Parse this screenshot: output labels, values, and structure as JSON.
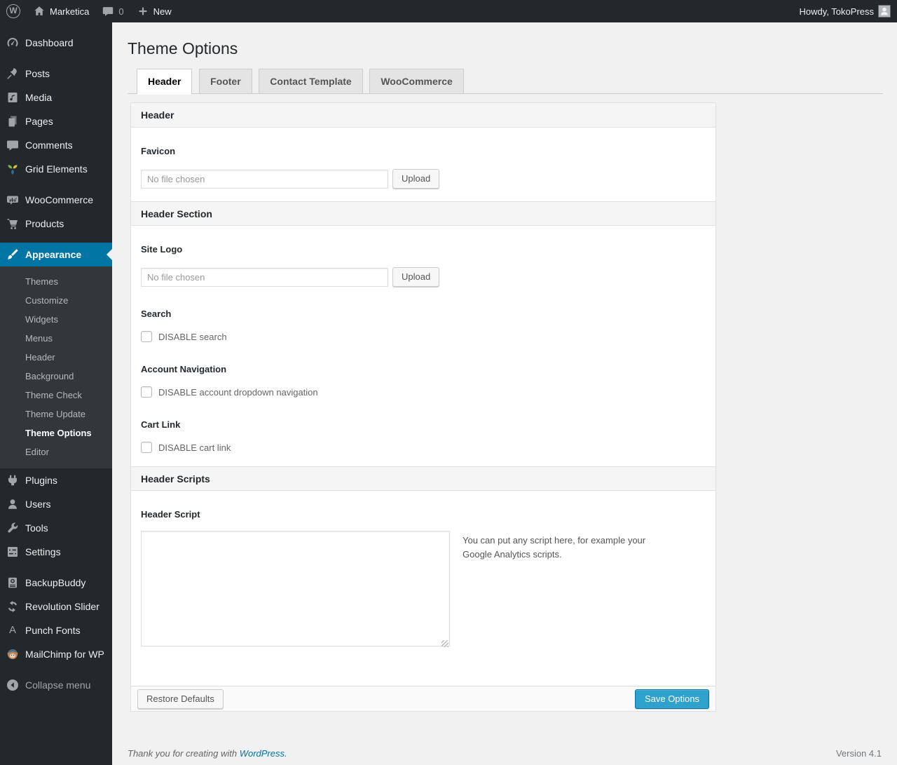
{
  "admin_bar": {
    "wp_logo_glyph": "W",
    "site_name": "Marketica",
    "comment_count": "0",
    "new_label": "New",
    "howdy": "Howdy, TokoPress"
  },
  "sidebar": {
    "items": [
      {
        "label": "Dashboard",
        "icon": "dashboard-icon"
      },
      {
        "label": "Posts",
        "icon": "posts-icon"
      },
      {
        "label": "Media",
        "icon": "media-icon"
      },
      {
        "label": "Pages",
        "icon": "pages-icon"
      },
      {
        "label": "Comments",
        "icon": "comments-icon"
      },
      {
        "label": "Grid Elements",
        "icon": "grid-elements-icon"
      },
      {
        "label": "WooCommerce",
        "icon": "woocommerce-icon"
      },
      {
        "label": "Products",
        "icon": "products-icon"
      },
      {
        "label": "Appearance",
        "icon": "appearance-icon"
      },
      {
        "label": "Plugins",
        "icon": "plugins-icon"
      },
      {
        "label": "Users",
        "icon": "users-icon"
      },
      {
        "label": "Tools",
        "icon": "tools-icon"
      },
      {
        "label": "Settings",
        "icon": "settings-icon"
      },
      {
        "label": "BackupBuddy",
        "icon": "backupbuddy-icon"
      },
      {
        "label": "Revolution Slider",
        "icon": "revolution-slider-icon"
      },
      {
        "label": "Punch Fonts",
        "icon": "punch-fonts-icon",
        "glyph": "A"
      },
      {
        "label": "MailChimp for WP",
        "icon": "mailchimp-icon"
      },
      {
        "label": "Collapse menu",
        "icon": "collapse-icon"
      }
    ],
    "appearance_submenu": [
      {
        "label": "Themes"
      },
      {
        "label": "Customize"
      },
      {
        "label": "Widgets"
      },
      {
        "label": "Menus"
      },
      {
        "label": "Header"
      },
      {
        "label": "Background"
      },
      {
        "label": "Theme Check"
      },
      {
        "label": "Theme Update"
      },
      {
        "label": "Theme Options",
        "current": true
      },
      {
        "label": "Editor"
      }
    ]
  },
  "main": {
    "title": "Theme Options",
    "tabs": [
      {
        "label": "Header",
        "active": true
      },
      {
        "label": "Footer"
      },
      {
        "label": "Contact Template"
      },
      {
        "label": "WooCommerce"
      }
    ],
    "panel": {
      "section_header": "Header",
      "favicon_label": "Favicon",
      "file_placeholder": "No file chosen",
      "upload_label": "Upload",
      "section_header_section": "Header Section",
      "site_logo_label": "Site Logo",
      "search_label": "Search",
      "search_checkbox": "DISABLE search",
      "account_nav_label": "Account Navigation",
      "account_nav_checkbox": "DISABLE account dropdown navigation",
      "cart_link_label": "Cart Link",
      "cart_link_checkbox": "DISABLE cart link",
      "section_header_scripts": "Header Scripts",
      "header_script_label": "Header Script",
      "header_script_help": "You can put any script here, for example your Google Analytics scripts.",
      "header_script_value": "",
      "restore_button": "Restore Defaults",
      "save_button": "Save Options"
    }
  },
  "page_footer": {
    "thanks_prefix": "Thank you for creating with ",
    "wordpress_link": "WordPress.",
    "version": "Version 4.1"
  },
  "colors": {
    "admin_bar_bg": "#23282d",
    "submenu_bg": "#32373c",
    "menu_highlight": "#0074a2",
    "primary_button": "#2ea2cc",
    "page_bg": "#f1f1f1"
  }
}
